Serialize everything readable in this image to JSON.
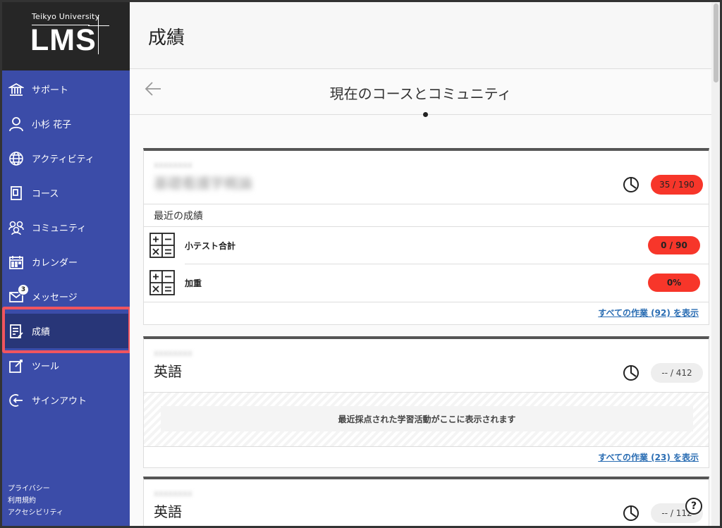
{
  "logo": {
    "sub": "Teikyo University",
    "main": "LMS"
  },
  "sidebar": {
    "items": [
      {
        "label": "サポート",
        "icon": "building-icon"
      },
      {
        "label": "小杉 花子",
        "icon": "user-icon"
      },
      {
        "label": "アクティビティ",
        "icon": "globe-icon"
      },
      {
        "label": "コース",
        "icon": "book-icon"
      },
      {
        "label": "コミュニティ",
        "icon": "people-icon"
      },
      {
        "label": "カレンダー",
        "icon": "calendar-icon"
      },
      {
        "label": "メッセージ",
        "icon": "mail-icon",
        "badge": "3"
      },
      {
        "label": "成績",
        "icon": "grades-icon"
      },
      {
        "label": "ツール",
        "icon": "edit-icon"
      },
      {
        "label": "サインアウト",
        "icon": "signout-icon"
      }
    ],
    "footer": [
      "プライバシー",
      "利用規約",
      "アクセシビリティ"
    ]
  },
  "header": {
    "title": "成績"
  },
  "subheader": {
    "title": "現在のコースとコミュニティ"
  },
  "cards": [
    {
      "course_name": "基礎看護学概論",
      "score": "35 / 190",
      "recent_title": "最近の成績",
      "grades": [
        {
          "name": "小テスト合計",
          "score": "0 / 90"
        },
        {
          "name": "加重",
          "score": "0%"
        }
      ],
      "view_all": "すべての作業 (92) を表示"
    },
    {
      "course_name": "英語",
      "score": "-- / 412",
      "empty_message": "最近採点された学習活動がここに表示されます",
      "view_all": "すべての作業 (23) を表示"
    },
    {
      "course_name": "英語",
      "score": "-- / 112"
    }
  ],
  "help": "?",
  "colors": {
    "sidebar": "#3b4ca8",
    "active": "#283678",
    "highlight": "#f0555f",
    "score_red": "#f7362a",
    "link": "#2a6db3"
  }
}
